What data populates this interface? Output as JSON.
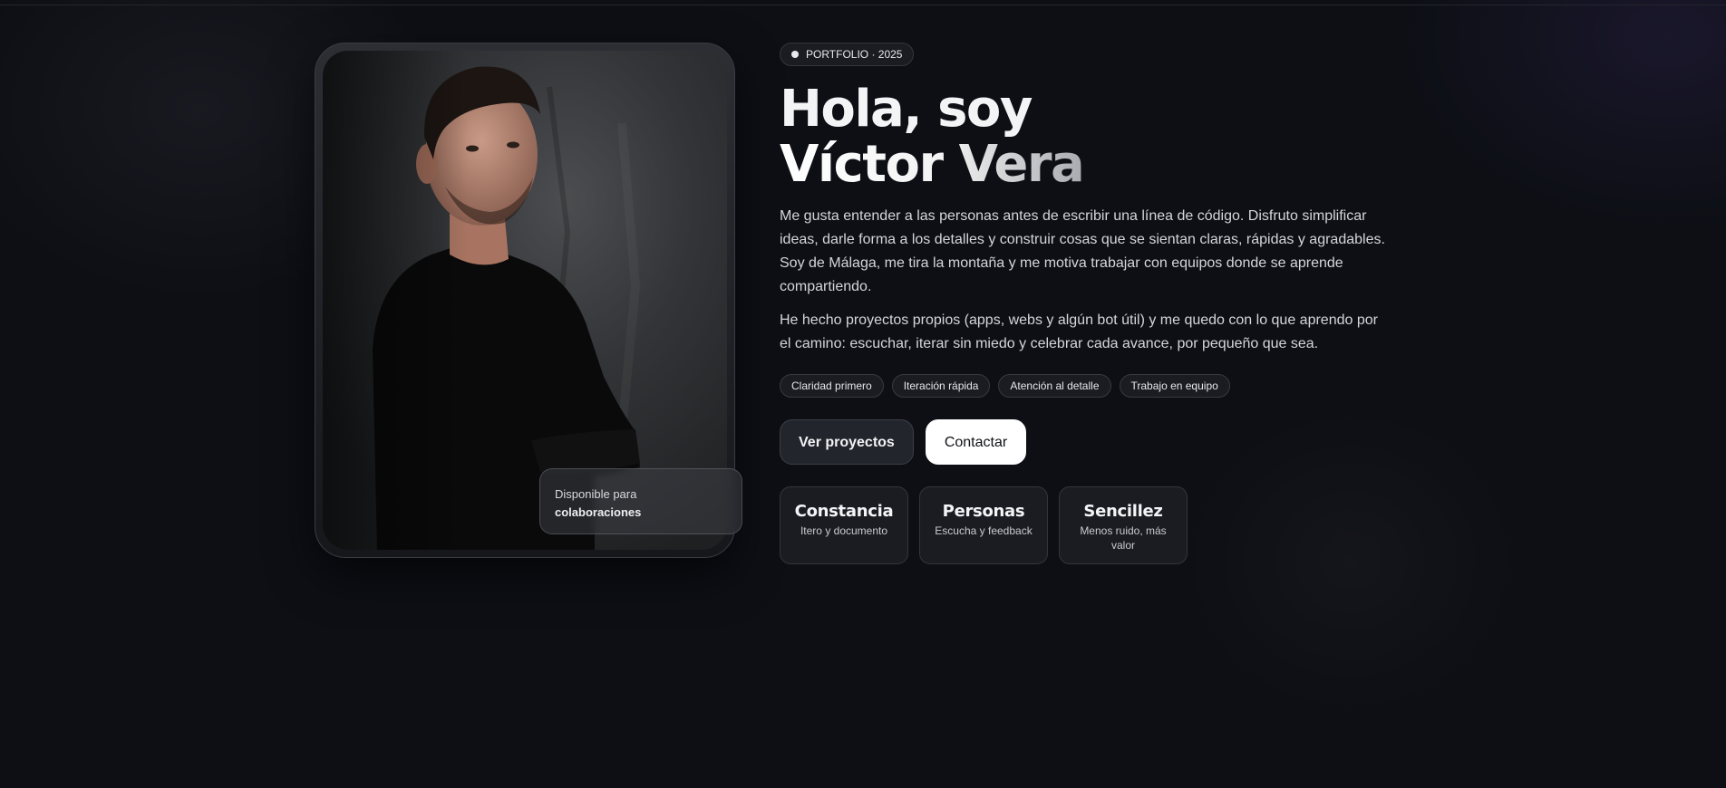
{
  "hero": {
    "badge": "PORTFOLIO · 2025",
    "title_line1": "Hola, soy",
    "title_line2": "Víctor Vera",
    "paragraph1": "Me gusta entender a las personas antes de escribir una línea de código. Disfruto simplificar ideas, darle forma a los detalles y construir cosas que se sientan claras, rápidas y agradables. Soy de Málaga, me tira la montaña y me motiva trabajar con equipos donde se aprende compartiendo.",
    "paragraph2": "He hecho proyectos propios (apps, webs y algún bot útil) y me quedo con lo que aprendo por el camino: escuchar, iterar sin miedo y celebrar cada avance, por pequeño que sea.",
    "chips": [
      "Claridad primero",
      "Iteración rápida",
      "Atención al detalle",
      "Trabajo en equipo"
    ],
    "buttons": {
      "projects": "Ver proyectos",
      "contact": "Contactar"
    },
    "stats": [
      {
        "title": "Constancia",
        "subtitle": "Itero y documento"
      },
      {
        "title": "Personas",
        "subtitle": "Escucha y feedback"
      },
      {
        "title": "Sencillez",
        "subtitle": "Menos ruido, más valor"
      }
    ]
  },
  "photo_card": {
    "availability_line1": "Disponible para",
    "availability_line2": "colaboraciones"
  },
  "colors": {
    "background": "#0d0f15",
    "card": "#1a1c22",
    "accent_light": "#ffffff"
  }
}
